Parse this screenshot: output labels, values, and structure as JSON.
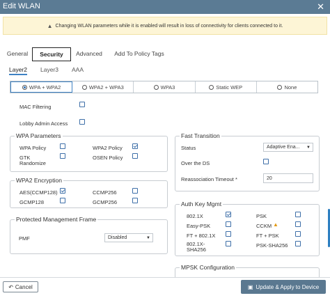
{
  "window": {
    "title": "Edit WLAN",
    "close_icon": "close-icon"
  },
  "warning": {
    "icon": "warning-icon",
    "text": "Changing WLAN parameters while it is enabled will result in loss of connectivity for clients connected to it."
  },
  "tabs": [
    {
      "label": "General"
    },
    {
      "label": "Security",
      "active": true
    },
    {
      "label": "Advanced"
    },
    {
      "label": "Add To Policy Tags"
    }
  ],
  "subtabs": [
    {
      "label": "Layer2",
      "active": true
    },
    {
      "label": "Layer3"
    },
    {
      "label": "AAA"
    }
  ],
  "security_modes": [
    {
      "label": "WPA + WPA2",
      "selected": true
    },
    {
      "label": "WPA2 + WPA3"
    },
    {
      "label": "WPA3"
    },
    {
      "label": "Static WEP"
    },
    {
      "label": "None"
    }
  ],
  "mac_filtering": {
    "label": "MAC Filtering",
    "checked": false
  },
  "lobby_admin": {
    "label": "Lobby Admin Access",
    "checked": false
  },
  "wpa_parameters": {
    "title": "WPA Parameters",
    "wpa_policy": {
      "label": "WPA Policy",
      "checked": false
    },
    "wpa2_policy": {
      "label": "WPA2 Policy",
      "checked": true
    },
    "gtk_randomize": {
      "label_1": "GTK",
      "label_2": "Randomize",
      "checked": false
    },
    "osen_policy": {
      "label": "OSEN Policy",
      "checked": false
    }
  },
  "wpa2_encryption": {
    "title": "WPA2 Encryption",
    "aes": {
      "label": "AES(CCMP128)",
      "checked": true
    },
    "ccmp256": {
      "label": "CCMP256",
      "checked": false
    },
    "gcmp128": {
      "label": "GCMP128",
      "checked": false
    },
    "gcmp256": {
      "label": "GCMP256",
      "checked": false
    }
  },
  "pmf": {
    "title": "Protected Management Frame",
    "label": "PMF",
    "value": "Disabled"
  },
  "fast_transition": {
    "title": "Fast Transition",
    "status_label": "Status",
    "status_value": "Adaptive Ena...",
    "over_ds_label": "Over the DS",
    "over_ds_checked": false,
    "reassoc_label": "Reassociation Timeout *",
    "reassoc_value": "20"
  },
  "akm": {
    "title": "Auth Key Mgmt",
    "dot1x": {
      "label": "802.1X",
      "checked": true
    },
    "psk": {
      "label": "PSK",
      "checked": false
    },
    "easy_psk": {
      "label": "Easy-PSK",
      "checked": false
    },
    "cckm": {
      "label": "CCKM",
      "checked": false,
      "icon": "warning-icon",
      "icon_color": "#e39a15"
    },
    "ft_dot1x": {
      "label": "FT + 802.1X",
      "checked": false
    },
    "ft_psk": {
      "label": "FT + PSK",
      "checked": false
    },
    "dot1x_sha256": {
      "label_1": "802.1X-",
      "label_2": "SHA256",
      "checked": false
    },
    "psk_sha256": {
      "label": "PSK-SHA256",
      "checked": false
    }
  },
  "mpsk": {
    "title": "MPSK Configuration"
  },
  "footer": {
    "cancel_label": "Cancel",
    "cancel_icon": "undo-icon",
    "apply_label": "Update & Apply to Device",
    "apply_icon": "save-icon"
  },
  "colors": {
    "header": "#5b7b94",
    "accent": "#3e82c4",
    "warning_bg": "#fdf5d6",
    "apply_button": "#5a7890"
  }
}
